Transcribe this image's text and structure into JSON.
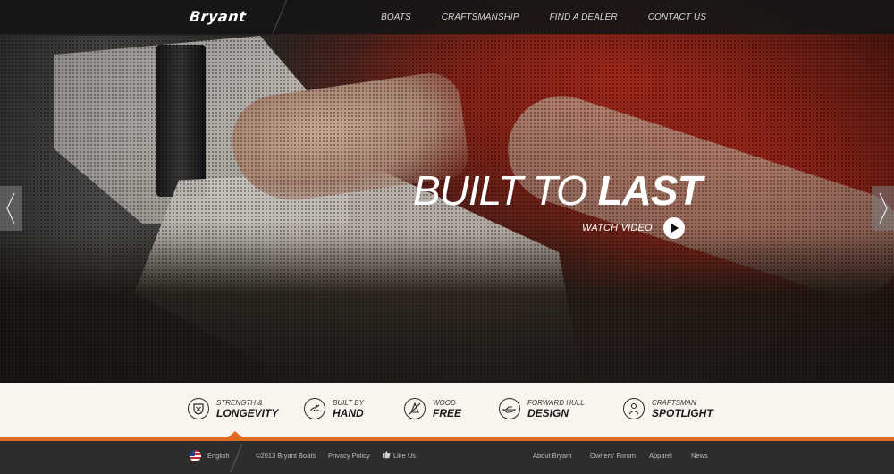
{
  "header": {
    "logo": "Bryant",
    "nav": [
      "Boats",
      "Craftsmanship",
      "Find a Dealer",
      "Contact Us"
    ]
  },
  "hero": {
    "headline_light": "BUILT TO",
    "headline_bold": "LAST",
    "watch_label": "WATCH VIDEO"
  },
  "features": [
    {
      "small": "STRENGTH &",
      "big": "LONGEVITY",
      "icon": "shield-icon"
    },
    {
      "small": "BUILT BY",
      "big": "HAND",
      "icon": "hand-icon"
    },
    {
      "small": "WOOD",
      "big": "FREE",
      "icon": "no-wood-icon"
    },
    {
      "small": "FORWARD HULL",
      "big": "DESIGN",
      "icon": "hull-icon"
    },
    {
      "small": "CRAFTSMAN",
      "big": "SPOTLIGHT",
      "icon": "craftsman-icon"
    }
  ],
  "footer": {
    "language": "English",
    "copyright": "©2013 Bryant Boats",
    "privacy": "Privacy Policy",
    "like": "Like Us",
    "links": [
      "About Bryant",
      "Owners' Forum",
      "Apparel",
      "News"
    ]
  },
  "colors": {
    "accent": "#e06a22",
    "header_bg": "#161616",
    "feature_bg": "#f7f5ee",
    "footer_bg": "#2d2d2d"
  }
}
